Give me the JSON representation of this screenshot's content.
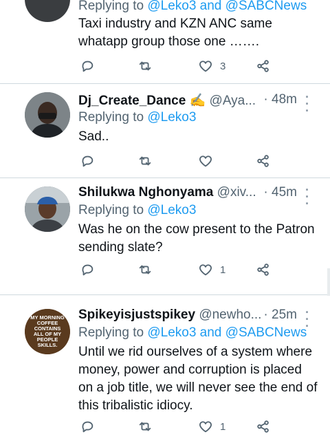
{
  "tweets": [
    {
      "name": "",
      "handle": "",
      "time": "",
      "replying_prefix": "Replying to ",
      "mentions": "@Leko3 and @SABCNews",
      "text": "Taxi industry and KZN ANC same whatapp group those one …….",
      "reply_count": "",
      "retweet_count": "",
      "like_count": "3"
    },
    {
      "name": "Dj_Create_Dance ✍",
      "handle": "@Aya...",
      "time": "· 48m",
      "replying_prefix": "Replying to ",
      "mentions": "@Leko3",
      "text": "Sad..",
      "like_count": ""
    },
    {
      "name": "Shilukwa Nghonyama",
      "handle": "@xiv...",
      "time": "· 45m",
      "replying_prefix": "Replying to ",
      "mentions": "@Leko3",
      "text": "Was he on the cow present to the Patron sending slate?",
      "like_count": "1"
    },
    {
      "name": "Spikeyisjustspikey",
      "handle": "@newho...",
      "time": "· 25m",
      "replying_prefix": "Replying to ",
      "mentions": "@Leko3 and @SABCNews",
      "text": "Until we rid ourselves of a system where money, power and corruption is placed on a job title, we will never see the end of this tribalistic idiocy.",
      "like_count": "1",
      "avatar_text": "MY MORNING COFFEE CONTAINS ALL OF MY PEOPLE SKILLS."
    }
  ],
  "icons": {
    "reply": "reply-icon",
    "retweet": "retweet-icon",
    "like": "heart-icon",
    "share": "share-icon",
    "more": "more-icon"
  },
  "colors": {
    "link": "#1d9bf0",
    "secondary_text": "#536471",
    "divider": "#cfd9de"
  }
}
